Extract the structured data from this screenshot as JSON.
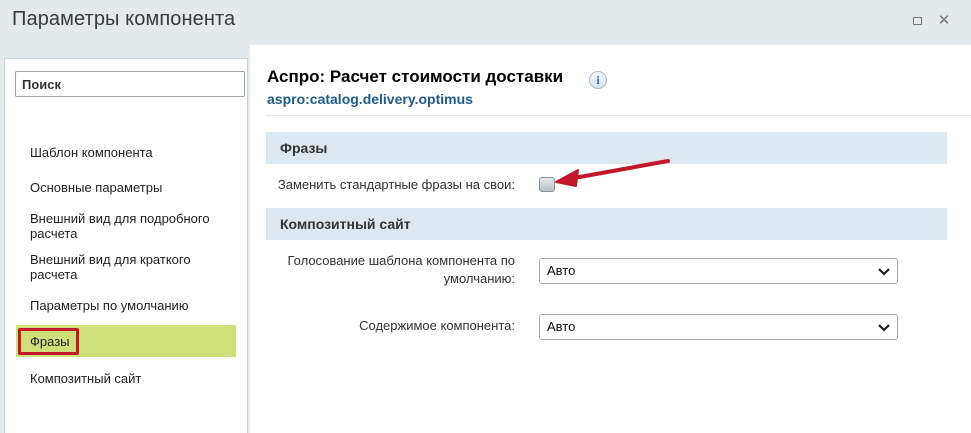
{
  "window": {
    "title": "Параметры компонента",
    "maximize_icon": "maximize-icon",
    "close_icon": "close-icon",
    "close_glyph": "✕"
  },
  "sidebar": {
    "search_placeholder": "Поиск",
    "items": [
      {
        "label": "Шаблон компонента"
      },
      {
        "label": "Основные параметры"
      },
      {
        "label": "Внешний вид для подробного\nрасчета"
      },
      {
        "label": "Внешний вид для краткого\nрасчета"
      },
      {
        "label": "Параметры по умолчанию"
      },
      {
        "label": "Фразы",
        "active": true
      },
      {
        "label": "Композитный сайт"
      }
    ],
    "active_color": "#cfe07a",
    "highlight_color": "#c4182a"
  },
  "main": {
    "component_title": "Аспро: Расчет стоимости доставки",
    "info_icon": "info-icon",
    "info_glyph": "i",
    "component_code": "aspro:catalog.delivery.optimus",
    "sections": [
      {
        "title": "Фразы",
        "fields": [
          {
            "label": "Заменить стандартные фразы на свои:",
            "type": "checkbox",
            "checked": false
          }
        ]
      },
      {
        "title": "Композитный сайт",
        "fields": [
          {
            "label": "Голосование шаблона компонента по\nумолчанию:",
            "type": "select",
            "value": "Авто"
          },
          {
            "label": "Содержимое компонента:",
            "type": "select",
            "value": "Авто"
          }
        ]
      }
    ],
    "annotation_arrow_color": "#c4182a"
  }
}
